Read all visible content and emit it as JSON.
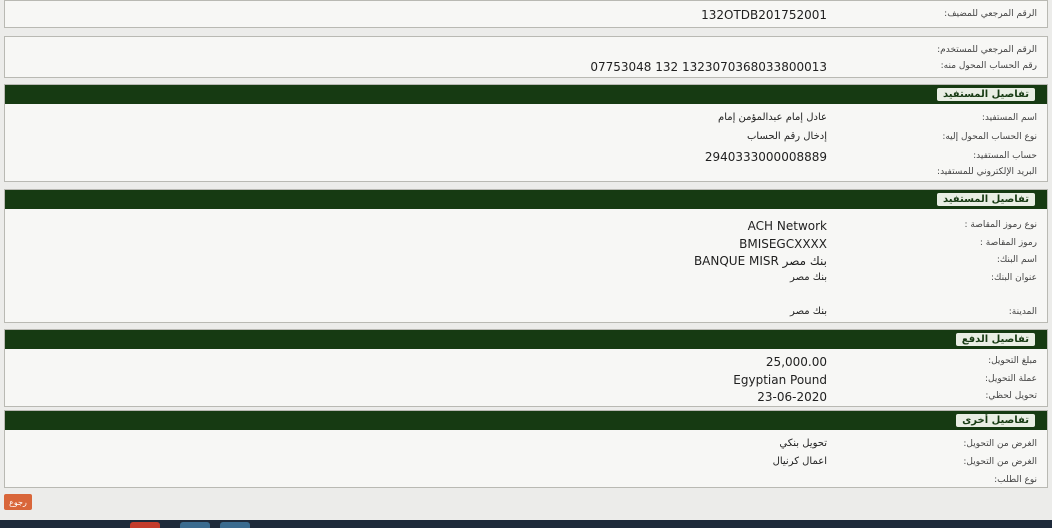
{
  "reference": {
    "customer_ref_label": "الرقم المرجعي للمضيف:",
    "customer_ref_value": "132OTDB201752001",
    "user_ref_label": "الرقم المرجعي للمستخدم:",
    "from_account_label": "رقم الحساب المحول منه:",
    "from_account_value": "07753048 132 1323070368033800013"
  },
  "beneficiary": {
    "title": "تفاصيل المستفيد",
    "name_label": "اسم المستفيد:",
    "name_value": "عادل إمام عبدالمؤمن إمام",
    "acct_type_label": "نوع الحساب المحول إليه:",
    "acct_type_value": "إدخال رقم الحساب",
    "acct_label": "حساب المستفيد:",
    "acct_value": "2940333000008889",
    "email_label": "البريد الإلكتروني للمستفيد:"
  },
  "bank": {
    "title": "تفاصيل المستفيد",
    "clearing_type_label": "نوع رموز المقاصة :",
    "clearing_type_value": "ACH Network",
    "clearing_code_label": "رموز المقاصة :",
    "clearing_code_value": "BMISEGCXXXX",
    "bank_name_label": "اسم البنك:",
    "bank_name_value": "BANQUE MISR بنك مصر",
    "bank_addr_label": "عنوان البنك:",
    "bank_addr_value": "بنك مصر",
    "city_label": "المدينة:",
    "city_value": "بنك مصر"
  },
  "payment": {
    "title": "تفاصيل الدفع",
    "amount_label": "مبلغ التحويل:",
    "amount_value": "25,000.00",
    "currency_label": "عملة التحويل:",
    "currency_value": "Egyptian Pound",
    "date_label": "تحويل لحظي:",
    "date_value": "23-06-2020"
  },
  "other": {
    "title": "تفاصيل أخرى",
    "purpose1_label": "الغرض من التحويل:",
    "purpose1_value": "تحويل بنكي",
    "purpose2_label": "الغرض من التحويل:",
    "purpose2_value": "اعمال كرنيال",
    "request_type_label": "نوع الطلب:"
  },
  "actions": {
    "back_label": "رجوع"
  },
  "colors": {
    "header_green": "#163a12",
    "button_orange": "#d9663a"
  }
}
